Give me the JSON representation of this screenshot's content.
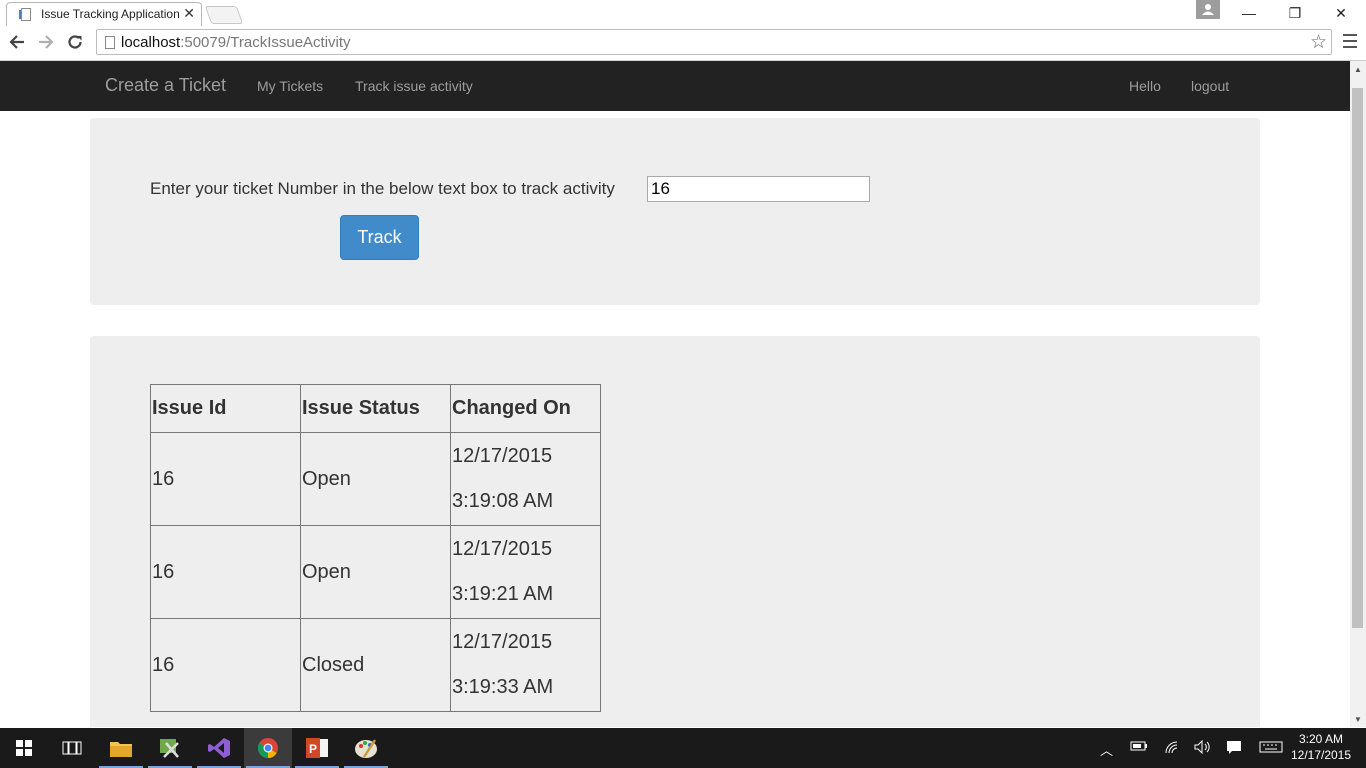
{
  "browser": {
    "tab_title": "Issue Tracking Application",
    "tab_close": "✕",
    "url_host": "localhost",
    "url_rest": ":50079/TrackIssueActivity",
    "window_controls": {
      "minimize": "—",
      "restore": "❐",
      "close": "✕"
    }
  },
  "navbar": {
    "brand": "Create a Ticket",
    "links": [
      "My Tickets",
      "Track issue activity"
    ],
    "right_links": [
      "Hello",
      "logout"
    ]
  },
  "track_form": {
    "prompt": "Enter your ticket Number in the below text box to track activity",
    "ticket_value": "16",
    "button_label": "Track"
  },
  "activity_table": {
    "headers": [
      "Issue Id",
      "Issue Status",
      "Changed On"
    ],
    "rows": [
      {
        "id": "16",
        "status": "Open",
        "date": "12/17/2015",
        "time": "3:19:08 AM"
      },
      {
        "id": "16",
        "status": "Open",
        "date": "12/17/2015",
        "time": "3:19:21 AM"
      },
      {
        "id": "16",
        "status": "Closed",
        "date": "12/17/2015",
        "time": "3:19:33 AM"
      }
    ]
  },
  "taskbar": {
    "clock_time": "3:20 AM",
    "clock_date": "12/17/2015",
    "apps": [
      "file-explorer-icon",
      "tools-icon",
      "visual-studio-icon",
      "chrome-icon",
      "powerpoint-icon",
      "paint-icon"
    ]
  },
  "colors": {
    "navbar_bg": "#222222",
    "well_bg": "#eeeeee",
    "primary_button": "#428bca"
  }
}
